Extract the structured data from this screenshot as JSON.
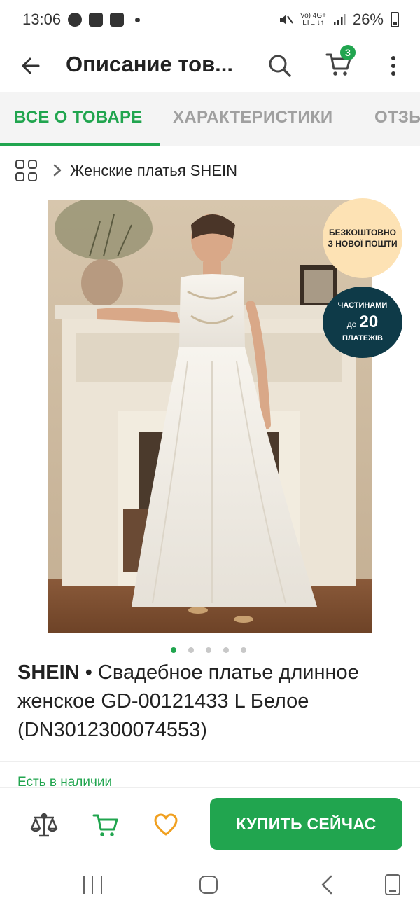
{
  "status_bar": {
    "time": "13:06",
    "network_top": "Vo) 4G+",
    "network_bottom": "LTE ↓↑",
    "battery": "26%",
    "notification_icons": [
      "facebook-icon",
      "gallery-icon",
      "instagram-icon"
    ]
  },
  "header": {
    "title": "Описание тов...",
    "cart_count": "3"
  },
  "tabs": [
    {
      "label": "ВСЕ О ТОВАРЕ",
      "active": true
    },
    {
      "label": "ХАРАКТЕРИСТИКИ",
      "active": false
    },
    {
      "label": "ОТЗЫВЫ",
      "active": false
    }
  ],
  "breadcrumb": {
    "category": "Женские платья SHEIN"
  },
  "promo_badges": {
    "free_delivery_line1": "БЕЗКОШТОВНО",
    "free_delivery_line2": "З НОВОЇ ПОШТИ",
    "installments_line1": "ЧАСТИНАМИ",
    "installments_prefix": "до",
    "installments_number": "20",
    "installments_line3": "ПЛАТЕЖІВ"
  },
  "gallery": {
    "current_index": 1,
    "total": 5
  },
  "product": {
    "brand": "SHEIN",
    "separator": " • ",
    "name": "Свадебное платье длинное женское GD-00121433 L Белое (DN3012300074553)",
    "stock_status": "Есть в наличии"
  },
  "action_bar": {
    "buy_label": "КУПИТЬ СЕЙЧАС"
  },
  "colors": {
    "accent": "#21a54f",
    "heart": "#f0a020",
    "promo_light": "#fde2b4",
    "promo_dark": "#0e3a48"
  }
}
